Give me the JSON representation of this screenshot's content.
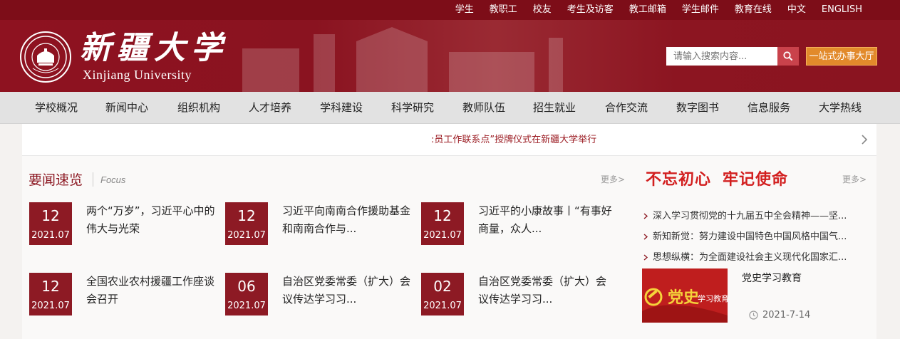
{
  "topbar": {
    "links": [
      "学生",
      "教职工",
      "校友",
      "考生及访客",
      "教工邮箱",
      "学生邮件",
      "教育在线",
      "中文",
      "ENGLISH"
    ]
  },
  "header": {
    "logo_cn": "新疆大学",
    "logo_en": "Xinjiang University",
    "search_placeholder": "请输入搜索内容...",
    "service_button": "一站式办事大厅"
  },
  "nav": {
    "items": [
      "学校概况",
      "新闻中心",
      "组织机构",
      "人才培养",
      "学科建设",
      "科学研究",
      "教师队伍",
      "招生就业",
      "合作交流",
      "数字图书",
      "信息服务",
      "大学热线"
    ]
  },
  "ticker": {
    "text": ":员工作联系点”授牌仪式在新疆大学举行"
  },
  "news": {
    "title": "要闻速览",
    "subtitle": "Focus",
    "more": "更多>",
    "items": [
      {
        "day": "12",
        "ym": "2021.07",
        "title": "两个“万岁”，习近平心中的伟大与光荣"
      },
      {
        "day": "12",
        "ym": "2021.07",
        "title": "习近平向南南合作援助基金和南南合作与..."
      },
      {
        "day": "12",
        "ym": "2021.07",
        "title": "习近平的小康故事丨“有事好商量，众人..."
      },
      {
        "day": "12",
        "ym": "2021.07",
        "title": "全国农业农村援疆工作座谈会召开"
      },
      {
        "day": "06",
        "ym": "2021.07",
        "title": "自治区党委常委（扩大）会议传达学习习..."
      },
      {
        "day": "02",
        "ym": "2021.07",
        "title": "自治区党委常委（扩大）会议传达学习习..."
      }
    ]
  },
  "campaign": {
    "slogan_a": "不忘初心",
    "slogan_b": "牢记使命",
    "more": "更多>",
    "items": [
      "深入学习贯彻党的十九届五中全会精神——坚...",
      "新知新觉：努力建设中国特色中国风格中国气...",
      "思想纵横：为全面建设社会主义现代化国家汇..."
    ],
    "feature_image_text_a": "党史",
    "feature_image_text_b": "学习教育",
    "feature_title": "党史学习教育",
    "feature_date": "2021-7-14"
  },
  "colors": {
    "brand": "#8d1a24",
    "topbar": "#7d0d18",
    "accent_orange": "#e28a2b",
    "slogan_red": "#d21f1f"
  }
}
